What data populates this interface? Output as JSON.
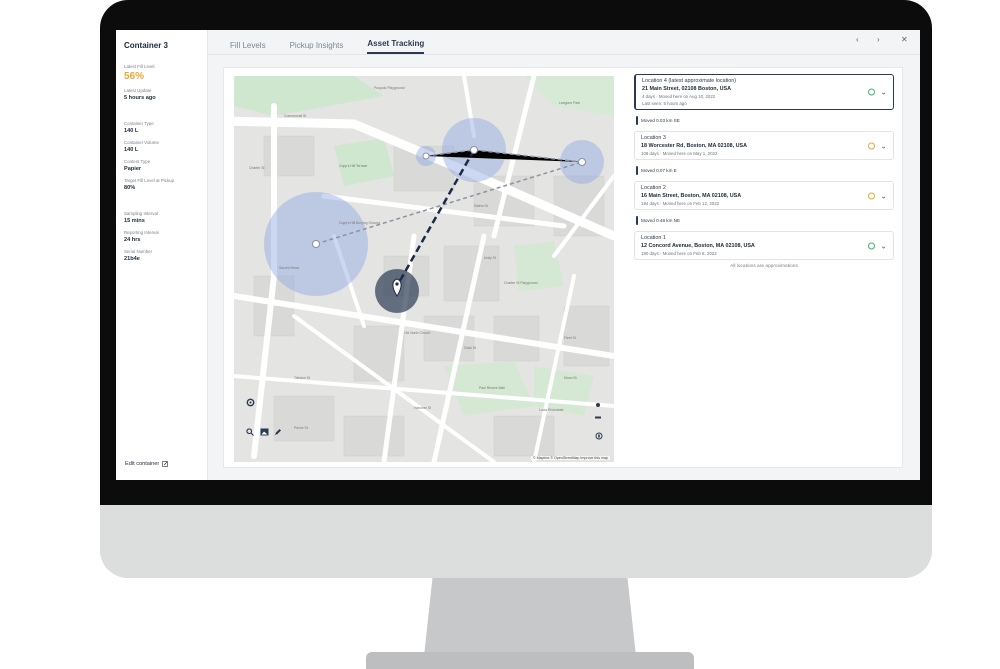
{
  "sidebar": {
    "title": "Container 3",
    "fields": [
      {
        "label": "Latest Fill Level",
        "value": "56%",
        "style": "big"
      },
      {
        "label": "Latest Update",
        "value": "5 hours ago"
      },
      {
        "label": "Container Type",
        "value": "140 L"
      },
      {
        "label": "Container Volume",
        "value": "140 L"
      },
      {
        "label": "Content Type",
        "value": "Papier"
      },
      {
        "label": "Target Fill Level at Pickup",
        "value": "80%"
      },
      {
        "label": "Sampling Interval",
        "value": "15 mins"
      },
      {
        "label": "Reporting Interval",
        "value": "24 hrs"
      },
      {
        "label": "Serial Number",
        "value": "21b4e"
      }
    ],
    "edit_label": "Edit container"
  },
  "tabs": [
    {
      "label": "Fill Levels",
      "active": false
    },
    {
      "label": "Pickup Insights",
      "active": false
    },
    {
      "label": "Asset Tracking",
      "active": true
    }
  ],
  "window": {
    "prev": "‹",
    "next": "›",
    "close": "✕"
  },
  "map": {
    "attribution": "© Mapbox © OpenStreetMap Improve this map",
    "street_labels": [
      "Commercial St",
      "Charter St",
      "Salem St",
      "Prince St",
      "Unity St",
      "Clark St",
      "Hanover St",
      "Tileston St",
      "Moon St",
      "Fleet St"
    ],
    "place_labels": [
      "Puopolo Playground",
      "Copp's Hill Terrace",
      "Copp's Hill Burying Ground",
      "Old North Church",
      "Paul Revere Mall",
      "Charter St Playground",
      "Langone Park",
      "Sacred Heart",
      "Lucia Ristorante"
    ]
  },
  "locations": [
    {
      "title": "Location 4 (latest approximate location)",
      "address": "21 Main Street, 02108 Boston, USA",
      "meta1": "4 days · Moved here on Aug 10, 2022",
      "meta2": "Last seen: 5 hours ago",
      "status": "ok",
      "latest": true
    },
    {
      "moved": "Moved 0.03 km SE"
    },
    {
      "title": "Location 3",
      "address": "18 Worcester Rd, Boston, MA 02108, USA",
      "meta1": "108 days · Moved here on May 1, 2022",
      "status": "warn"
    },
    {
      "moved": "Moved 0.07 km E"
    },
    {
      "title": "Location 2",
      "address": "16 Main Street, Boston, MA 02108, USA",
      "meta1": "184 days · Moved here on Feb 12, 2022",
      "status": "warn"
    },
    {
      "moved": "Moved 0.48 km NE"
    },
    {
      "title": "Location 1",
      "address": "12 Concord Avenue, Boston, MA 02108, USA",
      "meta1": "190 days · Moved here on Feb 8, 2022",
      "status": "ok"
    }
  ],
  "approx_note": "All locations are approximations",
  "colors": {
    "accent": "#2b3a52",
    "warn": "#f0a532",
    "ok": "#3cb371",
    "circle": "#8da6e3"
  }
}
